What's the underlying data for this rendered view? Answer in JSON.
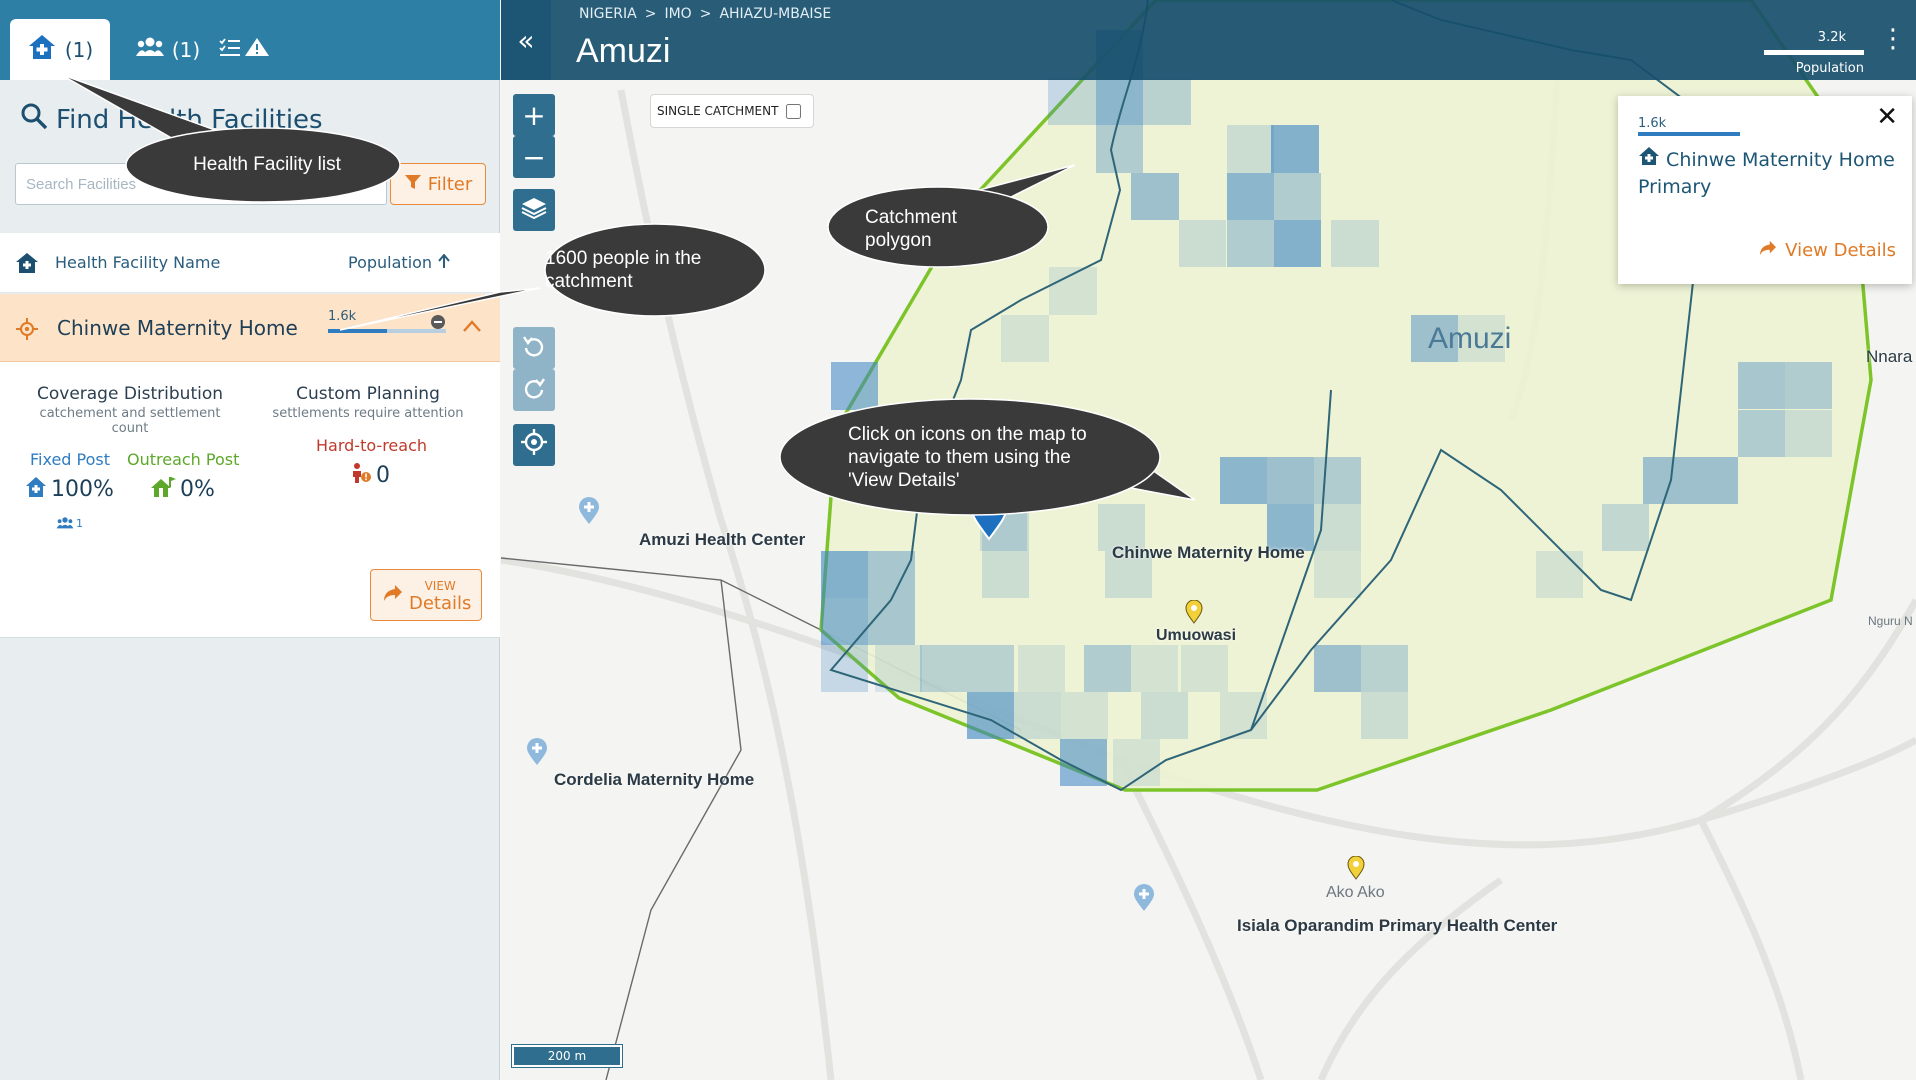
{
  "sidebar": {
    "tabs": [
      {
        "icon": "home-plus-icon",
        "count": "(1)"
      },
      {
        "icon": "people-icon",
        "count": "(1)"
      },
      {
        "icon": "tasks-warning-icon",
        "count": ""
      }
    ],
    "find_title": "Find Health Facilities",
    "search_placeholder": "Search Facilities",
    "filter_label": "Filter",
    "list_header": {
      "name": "Health Facility Name",
      "population": "Population"
    },
    "facility": {
      "name": "Chinwe Maternity Home",
      "population_label": "1.6k",
      "population_fraction": 0.5
    },
    "detail": {
      "coverage_title": "Coverage Distribution",
      "coverage_sub": "catchement and settlement count",
      "planning_title": "Custom Planning",
      "planning_sub": "settlements require attention",
      "fixed_post_label": "Fixed Post",
      "fixed_post_value": "100%",
      "fixed_post_count": "1",
      "outreach_label": "Outreach Post",
      "outreach_value": "0%",
      "hard_to_reach_label": "Hard-to-reach",
      "hard_to_reach_value": "0",
      "view_label": "VIEW",
      "details_label": "Details"
    }
  },
  "header": {
    "breadcrumb": [
      "NIGERIA",
      ">",
      "IMO",
      ">",
      "AHIAZU-MBAISE"
    ],
    "title": "Amuzi",
    "population_value": "3.2k",
    "population_label": "Population"
  },
  "map": {
    "single_catchment_label": "SINGLE CATCHMENT",
    "area_label": "Amuzi",
    "places": [
      {
        "name": "Amuzi Health Center"
      },
      {
        "name": "Chinwe Maternity Home"
      },
      {
        "name": "Umuowasi"
      },
      {
        "name": "Cordelia Maternity Home"
      },
      {
        "name": "Isiala Oparandim Primary Health Center"
      },
      {
        "name": "Ako Ako"
      },
      {
        "name": "Nnara"
      },
      {
        "name": "Nguru N"
      }
    ],
    "scale_label": "200 m"
  },
  "popup": {
    "population_label": "1.6k",
    "name": "Chinwe Maternity Home Primary",
    "view_label": "View Details"
  },
  "callouts": {
    "list": "Health Facility list",
    "people": "1600 people in the catchment",
    "catchment": "Catchment polygon",
    "icons": "Click on icons on the map to navigate to them using the 'View Details'"
  },
  "colors": {
    "header": "#164e6c",
    "tab_bar": "#2e7fa6",
    "accent_orange": "#e07a26",
    "selected_row": "#fde3c7",
    "catchment_outline": "#7dc42b",
    "density_blue": "#3b83c4"
  }
}
